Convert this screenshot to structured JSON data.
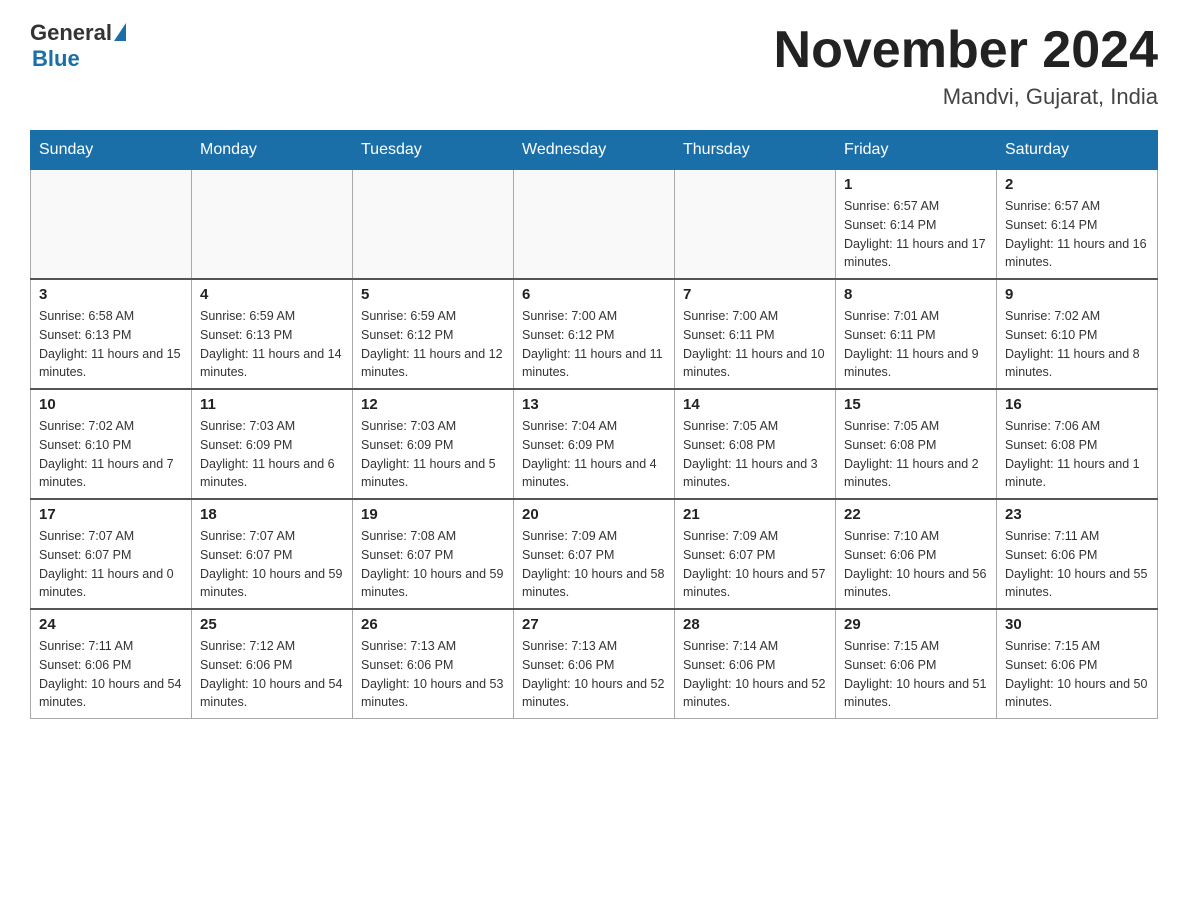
{
  "header": {
    "logo_general": "General",
    "logo_blue": "Blue",
    "month_title": "November 2024",
    "location": "Mandvi, Gujarat, India"
  },
  "days_of_week": [
    "Sunday",
    "Monday",
    "Tuesday",
    "Wednesday",
    "Thursday",
    "Friday",
    "Saturday"
  ],
  "weeks": [
    [
      {
        "day": "",
        "sunrise": "",
        "sunset": "",
        "daylight": ""
      },
      {
        "day": "",
        "sunrise": "",
        "sunset": "",
        "daylight": ""
      },
      {
        "day": "",
        "sunrise": "",
        "sunset": "",
        "daylight": ""
      },
      {
        "day": "",
        "sunrise": "",
        "sunset": "",
        "daylight": ""
      },
      {
        "day": "",
        "sunrise": "",
        "sunset": "",
        "daylight": ""
      },
      {
        "day": "1",
        "sunrise": "Sunrise: 6:57 AM",
        "sunset": "Sunset: 6:14 PM",
        "daylight": "Daylight: 11 hours and 17 minutes."
      },
      {
        "day": "2",
        "sunrise": "Sunrise: 6:57 AM",
        "sunset": "Sunset: 6:14 PM",
        "daylight": "Daylight: 11 hours and 16 minutes."
      }
    ],
    [
      {
        "day": "3",
        "sunrise": "Sunrise: 6:58 AM",
        "sunset": "Sunset: 6:13 PM",
        "daylight": "Daylight: 11 hours and 15 minutes."
      },
      {
        "day": "4",
        "sunrise": "Sunrise: 6:59 AM",
        "sunset": "Sunset: 6:13 PM",
        "daylight": "Daylight: 11 hours and 14 minutes."
      },
      {
        "day": "5",
        "sunrise": "Sunrise: 6:59 AM",
        "sunset": "Sunset: 6:12 PM",
        "daylight": "Daylight: 11 hours and 12 minutes."
      },
      {
        "day": "6",
        "sunrise": "Sunrise: 7:00 AM",
        "sunset": "Sunset: 6:12 PM",
        "daylight": "Daylight: 11 hours and 11 minutes."
      },
      {
        "day": "7",
        "sunrise": "Sunrise: 7:00 AM",
        "sunset": "Sunset: 6:11 PM",
        "daylight": "Daylight: 11 hours and 10 minutes."
      },
      {
        "day": "8",
        "sunrise": "Sunrise: 7:01 AM",
        "sunset": "Sunset: 6:11 PM",
        "daylight": "Daylight: 11 hours and 9 minutes."
      },
      {
        "day": "9",
        "sunrise": "Sunrise: 7:02 AM",
        "sunset": "Sunset: 6:10 PM",
        "daylight": "Daylight: 11 hours and 8 minutes."
      }
    ],
    [
      {
        "day": "10",
        "sunrise": "Sunrise: 7:02 AM",
        "sunset": "Sunset: 6:10 PM",
        "daylight": "Daylight: 11 hours and 7 minutes."
      },
      {
        "day": "11",
        "sunrise": "Sunrise: 7:03 AM",
        "sunset": "Sunset: 6:09 PM",
        "daylight": "Daylight: 11 hours and 6 minutes."
      },
      {
        "day": "12",
        "sunrise": "Sunrise: 7:03 AM",
        "sunset": "Sunset: 6:09 PM",
        "daylight": "Daylight: 11 hours and 5 minutes."
      },
      {
        "day": "13",
        "sunrise": "Sunrise: 7:04 AM",
        "sunset": "Sunset: 6:09 PM",
        "daylight": "Daylight: 11 hours and 4 minutes."
      },
      {
        "day": "14",
        "sunrise": "Sunrise: 7:05 AM",
        "sunset": "Sunset: 6:08 PM",
        "daylight": "Daylight: 11 hours and 3 minutes."
      },
      {
        "day": "15",
        "sunrise": "Sunrise: 7:05 AM",
        "sunset": "Sunset: 6:08 PM",
        "daylight": "Daylight: 11 hours and 2 minutes."
      },
      {
        "day": "16",
        "sunrise": "Sunrise: 7:06 AM",
        "sunset": "Sunset: 6:08 PM",
        "daylight": "Daylight: 11 hours and 1 minute."
      }
    ],
    [
      {
        "day": "17",
        "sunrise": "Sunrise: 7:07 AM",
        "sunset": "Sunset: 6:07 PM",
        "daylight": "Daylight: 11 hours and 0 minutes."
      },
      {
        "day": "18",
        "sunrise": "Sunrise: 7:07 AM",
        "sunset": "Sunset: 6:07 PM",
        "daylight": "Daylight: 10 hours and 59 minutes."
      },
      {
        "day": "19",
        "sunrise": "Sunrise: 7:08 AM",
        "sunset": "Sunset: 6:07 PM",
        "daylight": "Daylight: 10 hours and 59 minutes."
      },
      {
        "day": "20",
        "sunrise": "Sunrise: 7:09 AM",
        "sunset": "Sunset: 6:07 PM",
        "daylight": "Daylight: 10 hours and 58 minutes."
      },
      {
        "day": "21",
        "sunrise": "Sunrise: 7:09 AM",
        "sunset": "Sunset: 6:07 PM",
        "daylight": "Daylight: 10 hours and 57 minutes."
      },
      {
        "day": "22",
        "sunrise": "Sunrise: 7:10 AM",
        "sunset": "Sunset: 6:06 PM",
        "daylight": "Daylight: 10 hours and 56 minutes."
      },
      {
        "day": "23",
        "sunrise": "Sunrise: 7:11 AM",
        "sunset": "Sunset: 6:06 PM",
        "daylight": "Daylight: 10 hours and 55 minutes."
      }
    ],
    [
      {
        "day": "24",
        "sunrise": "Sunrise: 7:11 AM",
        "sunset": "Sunset: 6:06 PM",
        "daylight": "Daylight: 10 hours and 54 minutes."
      },
      {
        "day": "25",
        "sunrise": "Sunrise: 7:12 AM",
        "sunset": "Sunset: 6:06 PM",
        "daylight": "Daylight: 10 hours and 54 minutes."
      },
      {
        "day": "26",
        "sunrise": "Sunrise: 7:13 AM",
        "sunset": "Sunset: 6:06 PM",
        "daylight": "Daylight: 10 hours and 53 minutes."
      },
      {
        "day": "27",
        "sunrise": "Sunrise: 7:13 AM",
        "sunset": "Sunset: 6:06 PM",
        "daylight": "Daylight: 10 hours and 52 minutes."
      },
      {
        "day": "28",
        "sunrise": "Sunrise: 7:14 AM",
        "sunset": "Sunset: 6:06 PM",
        "daylight": "Daylight: 10 hours and 52 minutes."
      },
      {
        "day": "29",
        "sunrise": "Sunrise: 7:15 AM",
        "sunset": "Sunset: 6:06 PM",
        "daylight": "Daylight: 10 hours and 51 minutes."
      },
      {
        "day": "30",
        "sunrise": "Sunrise: 7:15 AM",
        "sunset": "Sunset: 6:06 PM",
        "daylight": "Daylight: 10 hours and 50 minutes."
      }
    ]
  ]
}
